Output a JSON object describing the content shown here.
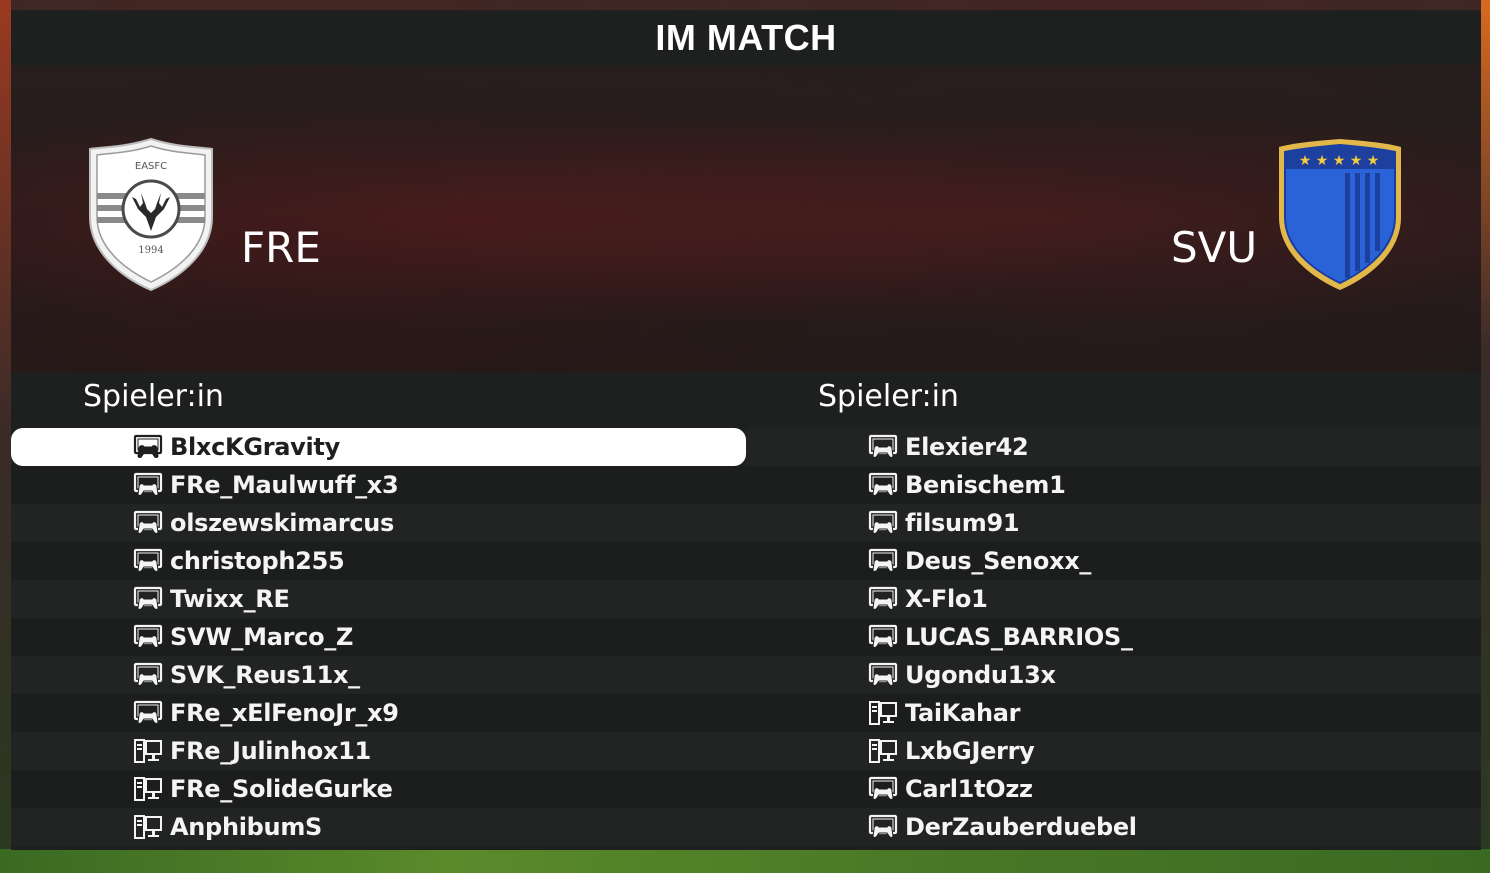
{
  "title": "IM MATCH",
  "home": {
    "name": "FRE",
    "crest_top_text": "EASFC",
    "crest_bottom_text": "1994",
    "players_header": "Spieler:in",
    "players": [
      {
        "name": "BlxcKGravity",
        "platform": "console-icon",
        "selected": true
      },
      {
        "name": "FRe_Maulwuff_x3",
        "platform": "console-icon"
      },
      {
        "name": "olszewskimarcus",
        "platform": "console-icon"
      },
      {
        "name": "christoph255",
        "platform": "console-icon"
      },
      {
        "name": "Twixx_RE",
        "platform": "console-icon"
      },
      {
        "name": "SVW_Marco_Z",
        "platform": "console-icon"
      },
      {
        "name": "SVK_Reus11x_",
        "platform": "console-icon"
      },
      {
        "name": "FRe_xElFenoJr_x9",
        "platform": "console-icon"
      },
      {
        "name": "FRe_Julinhox11",
        "platform": "pc-icon"
      },
      {
        "name": "FRe_SolideGurke",
        "platform": "pc-icon"
      },
      {
        "name": "AnphibumS",
        "platform": "pc-icon"
      }
    ]
  },
  "away": {
    "name": "SVU",
    "players_header": "Spieler:in",
    "players": [
      {
        "name": "Elexier42",
        "platform": "console-icon"
      },
      {
        "name": "Benischem1",
        "platform": "console-icon"
      },
      {
        "name": "filsum91",
        "platform": "console-icon"
      },
      {
        "name": "Deus_Senoxx_",
        "platform": "console-icon"
      },
      {
        "name": "X-Flo1",
        "platform": "console-icon"
      },
      {
        "name": "LUCAS_BARRIOS_",
        "platform": "console-icon"
      },
      {
        "name": "Ugondu13x",
        "platform": "console-icon"
      },
      {
        "name": "TaiKahar",
        "platform": "pc-icon"
      },
      {
        "name": "LxbGJerry",
        "platform": "pc-icon"
      },
      {
        "name": "Carl1tOzz",
        "platform": "console-icon"
      },
      {
        "name": "DerZauberduebel",
        "platform": "console-icon"
      }
    ]
  },
  "colors": {
    "panel": "#1e1f1f",
    "selected_row": "#ffffff",
    "away_crest": "#2a62d8",
    "away_crest_border": "#e3b84a"
  }
}
